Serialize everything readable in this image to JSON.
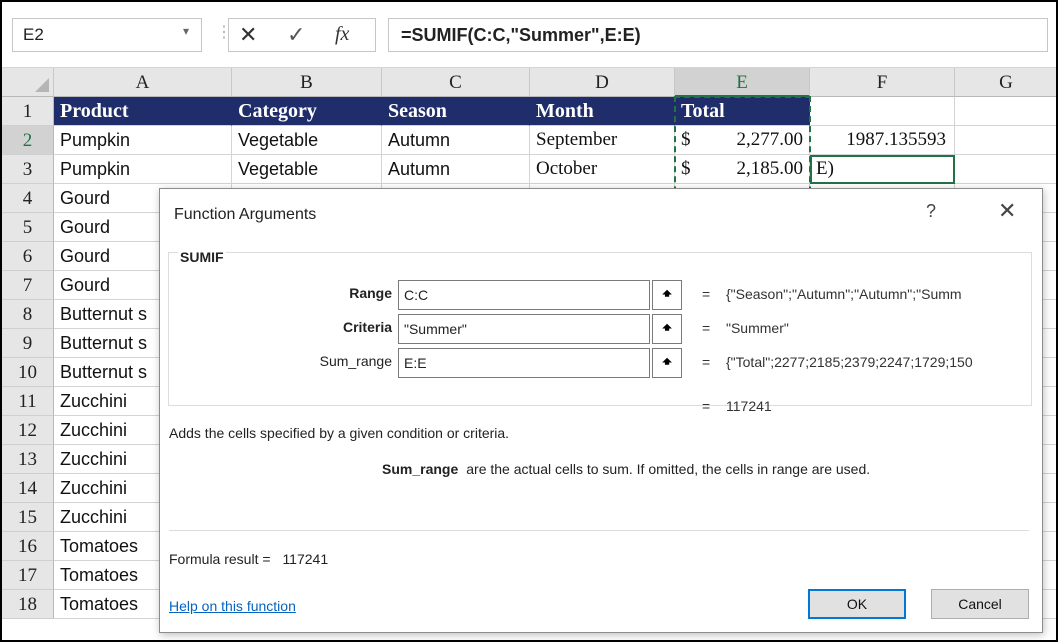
{
  "formula_bar": {
    "name_box": "E2",
    "cancel_icon": "✕",
    "enter_icon": "✓",
    "fx_icon": "fx",
    "formula": "=SUMIF(C:C,\"Summer\",E:E)"
  },
  "columns": [
    "A",
    "B",
    "C",
    "D",
    "E",
    "F",
    "G"
  ],
  "rows": [
    {
      "n": "1",
      "a": "Product",
      "b": "Category",
      "c": "Season",
      "d": "Month",
      "e_sym": "Total",
      "e_num": "",
      "f": ""
    },
    {
      "n": "2",
      "a": "Pumpkin",
      "b": "Vegetable",
      "c": "Autumn",
      "d": "September",
      "e_sym": "$",
      "e_num": "2,277.00",
      "f": "1987.135593"
    },
    {
      "n": "3",
      "a": "Pumpkin",
      "b": "Vegetable",
      "c": "Autumn",
      "d": "October",
      "e_sym": "$",
      "e_num": "2,185.00",
      "f": "E)"
    },
    {
      "n": "4",
      "a": "Gourd"
    },
    {
      "n": "5",
      "a": "Gourd"
    },
    {
      "n": "6",
      "a": "Gourd"
    },
    {
      "n": "7",
      "a": "Gourd"
    },
    {
      "n": "8",
      "a": "Butternut s"
    },
    {
      "n": "9",
      "a": "Butternut s"
    },
    {
      "n": "10",
      "a": "Butternut s"
    },
    {
      "n": "11",
      "a": "Zucchini"
    },
    {
      "n": "12",
      "a": "Zucchini"
    },
    {
      "n": "13",
      "a": "Zucchini"
    },
    {
      "n": "14",
      "a": "Zucchini"
    },
    {
      "n": "15",
      "a": "Zucchini"
    },
    {
      "n": "16",
      "a": "Tomatoes"
    },
    {
      "n": "17",
      "a": "Tomatoes"
    },
    {
      "n": "18",
      "a": "Tomatoes"
    }
  ],
  "dialog": {
    "title": "Function Arguments",
    "help_icon": "?",
    "close_icon": "✕",
    "function_name": "SUMIF",
    "args": [
      {
        "label": "Range",
        "value": "C:C",
        "result": "{\"Season\";\"Autumn\";\"Autumn\";\"Summ"
      },
      {
        "label": "Criteria",
        "value": "\"Summer\"",
        "result": "\"Summer\""
      },
      {
        "label": "Sum_range",
        "value": "E:E",
        "result": "{\"Total\";2277;2185;2379;2247;1729;150"
      }
    ],
    "equals": "=",
    "collapse_icon": "🠹",
    "function_result": "117241",
    "description": "Adds the cells specified by a given condition or criteria.",
    "arg_desc_name": "Sum_range",
    "arg_desc_text": "are the actual cells to sum. If omitted, the cells in range are used.",
    "formula_result_label": "Formula result =",
    "formula_result_value": "117241",
    "help_link": "Help on this function",
    "ok_label": "OK",
    "cancel_label": "Cancel"
  }
}
